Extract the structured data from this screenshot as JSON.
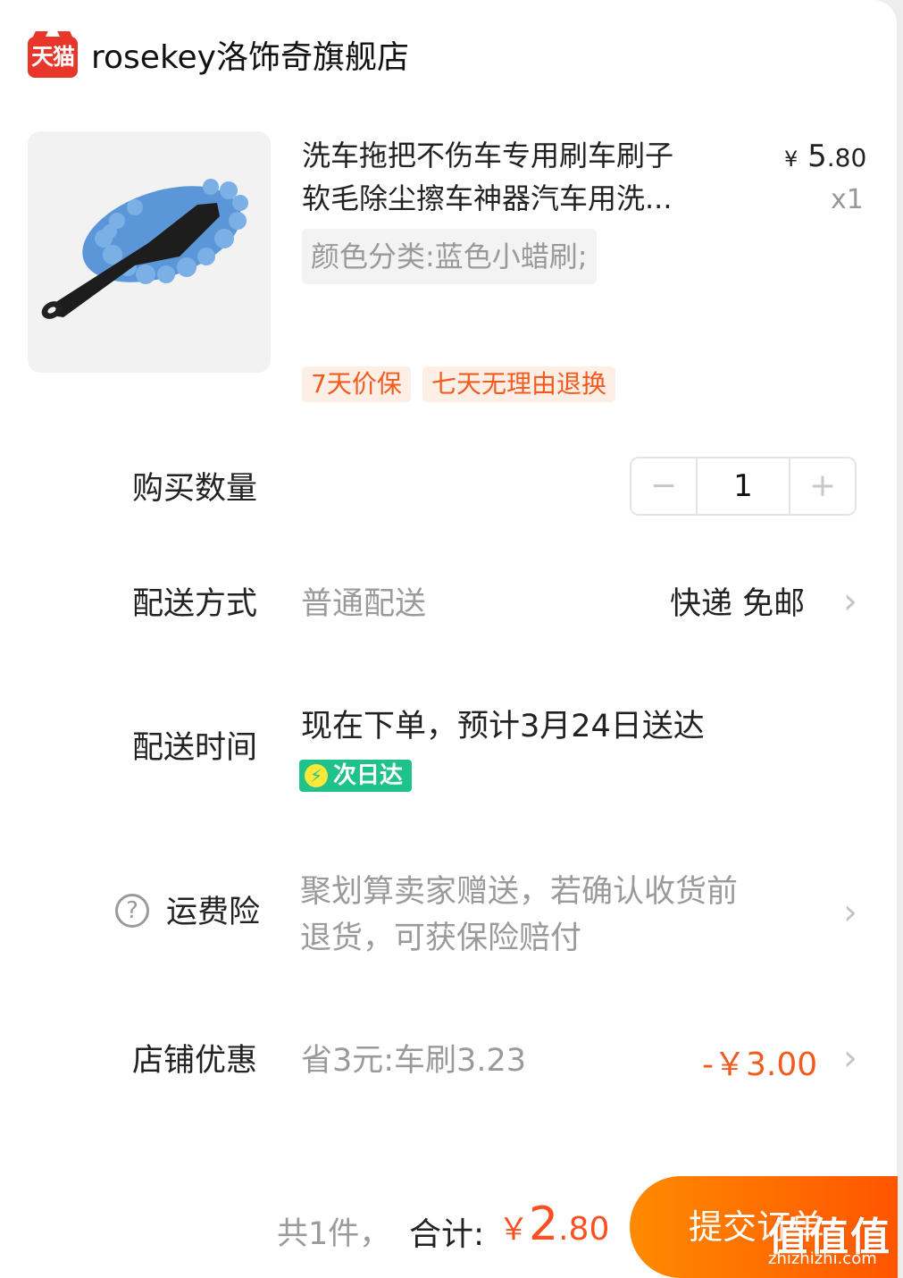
{
  "shop": {
    "badge": "天猫",
    "name": "rosekey洛饰奇旗舰店"
  },
  "product": {
    "title_line1": "洗车拖把不伤车专用刷车刷子",
    "title_line2": "软毛除尘擦车神器汽车用洗...",
    "price_symbol": "¥",
    "price_int": "5",
    "price_dec": ".80",
    "quantity_text": "x1",
    "sku": "颜色分类:蓝色小蜡刷;",
    "tags": [
      "7天价保",
      "七天无理由退换"
    ]
  },
  "rows": {
    "quantity": {
      "label": "购买数量",
      "value": "1",
      "minus": "−",
      "plus": "+"
    },
    "delivery_method": {
      "label": "配送方式",
      "sub": "普通配送",
      "value": "快递 免邮"
    },
    "delivery_time": {
      "label": "配送时间",
      "value": "现在下单，预计3月24日送达",
      "badge": "次日达"
    },
    "insurance": {
      "label": "运费险",
      "desc_line1": "聚划算卖家赠送，若确认收货前",
      "desc_line2": "退货，可获保险赔付"
    },
    "shop_discount": {
      "label": "店铺优惠",
      "sub": "省3元:车刷3.23",
      "value": "-￥3.00"
    }
  },
  "footer": {
    "count": "共1件，",
    "total_label": "合计:",
    "total_symbol": "￥",
    "total_int": "2",
    "total_dec": ".80",
    "submit": "提交订单"
  },
  "watermark": {
    "big": "值值值",
    "small": "zhizhizhi.com"
  },
  "colors": {
    "accent": "#ff5500",
    "tag_text": "#f25a1e",
    "tmall_red": "#e8362a",
    "nextday_green": "#1fc28a"
  }
}
